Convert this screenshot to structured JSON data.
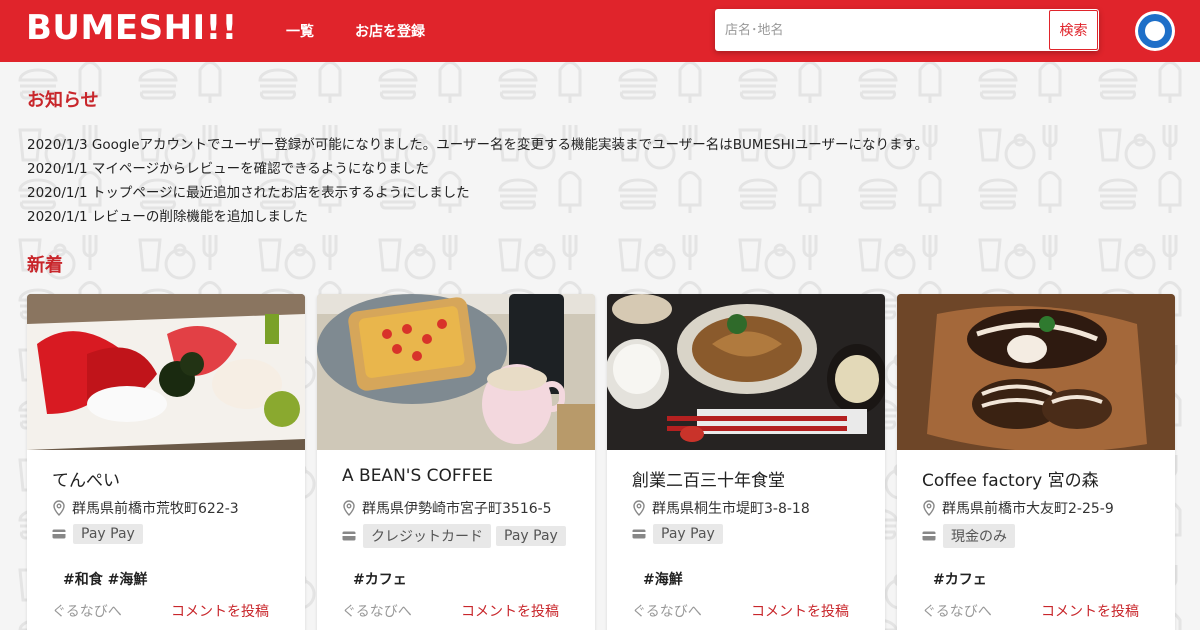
{
  "header": {
    "logo": "BUMESHI!!",
    "nav": [
      {
        "label": "一覧"
      },
      {
        "label": "お店を登録"
      }
    ],
    "search": {
      "placeholder": "店名･地名",
      "button_label": "検索"
    },
    "brand_color": "#e0242b"
  },
  "notices": {
    "title": "お知らせ",
    "items": [
      "2020/1/3 Googleアカウントでユーザー登録が可能になりました。ユーザー名を変更する機能実装までユーザー名はBUMESHIユーザーになります。",
      "2020/1/1 マイページからレビューを確認できるようになりました",
      "2020/1/1 トップページに最近追加されたお店を表示するようにしました",
      "2020/1/1 レビューの削除機能を追加しました"
    ]
  },
  "new_arrivals": {
    "title": "新着",
    "cards": [
      {
        "name": "てんぺい",
        "address": "群馬県前橋市荒牧町622-3",
        "payments": [
          "Pay Pay"
        ],
        "tags": "#和食 #海鮮",
        "gnavi_label": "ぐるなびへ",
        "comment_label": "コメントを投稿",
        "image": "sashimi-photo"
      },
      {
        "name": "A BEAN'S COFFEE",
        "address": "群馬県伊勢崎市宮子町3516-5",
        "payments": [
          "クレジットカード",
          "Pay Pay"
        ],
        "tags": "#カフェ",
        "gnavi_label": "ぐるなびへ",
        "comment_label": "コメントを投稿",
        "image": "toast-coffee-photo"
      },
      {
        "name": "創業二百三十年食堂",
        "address": "群馬県桐生市堤町3-8-18",
        "payments": [
          "Pay Pay"
        ],
        "tags": "#海鮮",
        "gnavi_label": "ぐるなびへ",
        "comment_label": "コメントを投稿",
        "image": "fish-set-meal-photo"
      },
      {
        "name": "Coffee factory 宮の森",
        "address": "群馬県前橋市大友町2-25-9",
        "payments": [
          "現金のみ"
        ],
        "tags": "#カフェ",
        "gnavi_label": "ぐるなびへ",
        "comment_label": "コメントを投稿",
        "image": "chocolate-dessert-photo"
      }
    ]
  }
}
